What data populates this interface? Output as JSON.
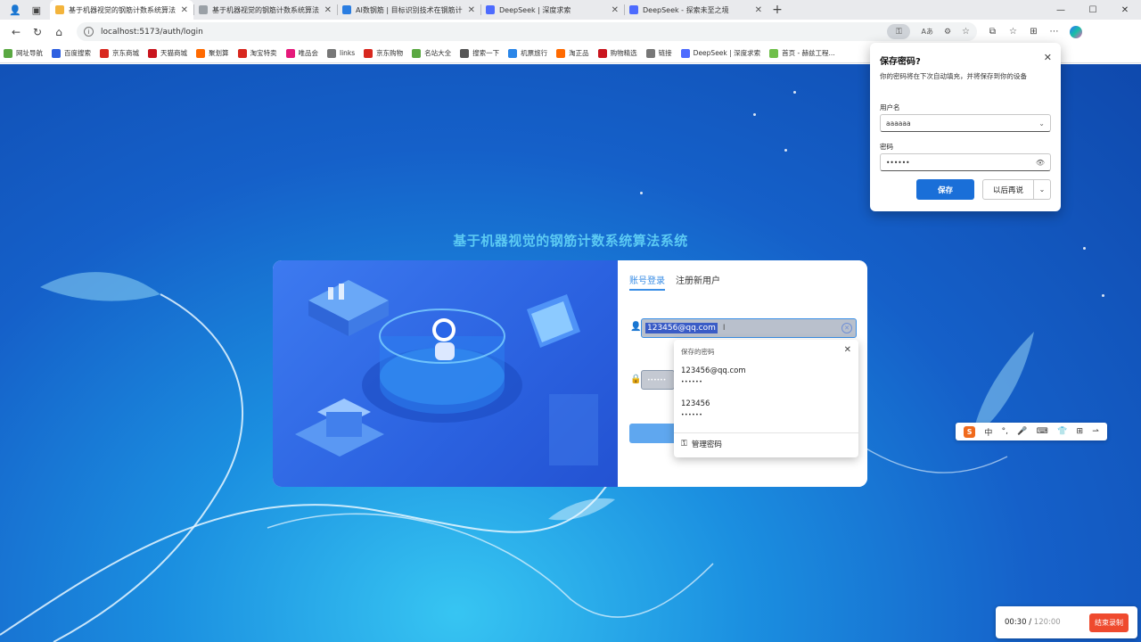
{
  "browser": {
    "tabs": [
      {
        "title": "基于机器视觉的钢筋计数系统算法",
        "favicon_color": "#f3b43c",
        "active": true
      },
      {
        "title": "基于机器视觉的钢筋计数系统算法",
        "favicon_color": "#9aa0a6",
        "active": false
      },
      {
        "title": "AI数钢筋 | 目标识别技术在钢筋计",
        "favicon_color": "#2a7de1",
        "active": false
      },
      {
        "title": "DeepSeek | 深度求索",
        "favicon_color": "#4d6bfe",
        "active": false
      },
      {
        "title": "DeepSeek - 探索未至之境",
        "favicon_color": "#4d6bfe",
        "active": false
      }
    ],
    "url": "localhost:5173/auth/login",
    "bookmarks": [
      {
        "label": "网址导航",
        "color": "#5aa842"
      },
      {
        "label": "百度搜索",
        "color": "#2d5fe0"
      },
      {
        "label": "京东商城",
        "color": "#d8281f"
      },
      {
        "label": "天猫商城",
        "color": "#c9151e"
      },
      {
        "label": "聚划算",
        "color": "#ff6a00"
      },
      {
        "label": "淘宝特卖",
        "color": "#d8281f"
      },
      {
        "label": "唯品会",
        "color": "#e5197a"
      },
      {
        "label": "links",
        "color": "#777777"
      },
      {
        "label": "京东购物",
        "color": "#d8281f"
      },
      {
        "label": "名站大全",
        "color": "#5aa842"
      },
      {
        "label": "搜索一下",
        "color": "#555555"
      },
      {
        "label": "机票旅行",
        "color": "#2a86e8"
      },
      {
        "label": "淘正品",
        "color": "#ff6a00"
      },
      {
        "label": "购物精选",
        "color": "#c9151e"
      },
      {
        "label": "链接",
        "color": "#777777"
      },
      {
        "label": "DeepSeek | 深度求索",
        "color": "#4d6bfe"
      },
      {
        "label": "首页 - 赫兹工程...",
        "color": "#6fbf4a"
      }
    ]
  },
  "page": {
    "title": "基于机器视觉的钢筋计数系统算法系统",
    "tabs": {
      "login": "账号登录",
      "register": "注册新用户"
    },
    "email_value": "123456@qq.com",
    "password_mask": "••••••",
    "saved_dropdown": {
      "header": "保存的密码",
      "entries": [
        {
          "username": "123456@qq.com",
          "password": "••••••"
        },
        {
          "username": "123456",
          "password": "••••••"
        }
      ],
      "manage": "管理密码"
    }
  },
  "save_password_popup": {
    "title": "保存密码?",
    "description": "你的密码将在下次自动填充，并将保存到你的设备",
    "username_label": "用户名",
    "username_value": "aaaaaa",
    "password_label": "密码",
    "password_value": "••••••",
    "save_button": "保存",
    "later_button": "以后再说"
  },
  "recorder": {
    "elapsed": "00:30",
    "total": "120:00",
    "stop_button": "结束录制"
  },
  "colors": {
    "accent": "#3a8ee6",
    "save_button": "#1a6fd8",
    "record_stop": "#ef4a2e"
  }
}
